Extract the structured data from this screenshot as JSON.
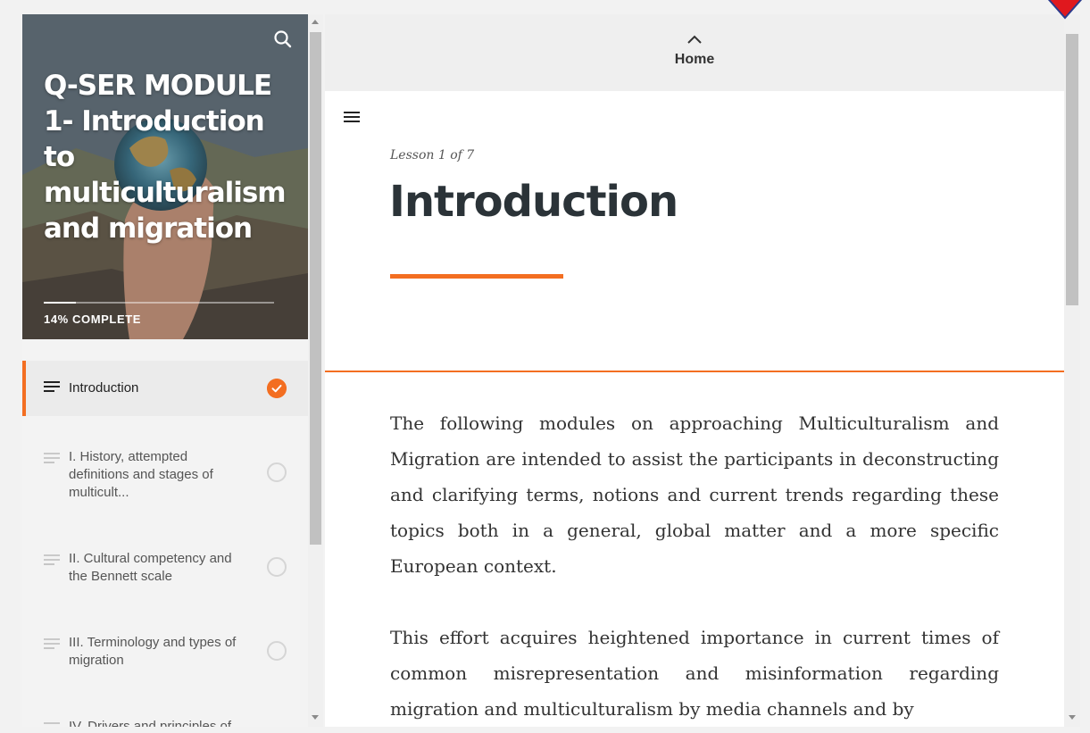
{
  "sidebar": {
    "course_title": "Q-SER MODULE 1- Introduction to multiculturalism and migration",
    "progress_percent": 14,
    "progress_text": "14% COMPLETE",
    "lessons": [
      {
        "label": "Introduction",
        "status": "complete",
        "active": true
      },
      {
        "label": "I. History, attempted definitions and stages of multicult...",
        "status": "incomplete",
        "active": false
      },
      {
        "label": "II. Cultural competency and the Bennett scale",
        "status": "incomplete",
        "active": false
      },
      {
        "label": "III. Terminology and types of migration",
        "status": "incomplete",
        "active": false
      },
      {
        "label": "IV. Drivers and principles of",
        "status": "incomplete",
        "active": false
      }
    ]
  },
  "topbar": {
    "home_label": "Home"
  },
  "lesson": {
    "count_label": "Lesson 1 of 7",
    "title": "Introduction",
    "paragraphs": [
      "The following modules on approaching Multiculturalism and Migration are intended to assist the participants in deconstructing and clarifying terms, notions and current trends regarding these topics both in a general, global matter and a more specific European context.",
      "This effort acquires heightened importance in current times of common misrepresentation and misinformation regarding migration and multiculturalism by media channels and by"
    ]
  },
  "colors": {
    "accent": "#f36e21"
  },
  "icons": {
    "search": "search-icon",
    "menu": "hamburger-menu-icon",
    "up": "chevron-up-icon",
    "check": "check-icon"
  }
}
